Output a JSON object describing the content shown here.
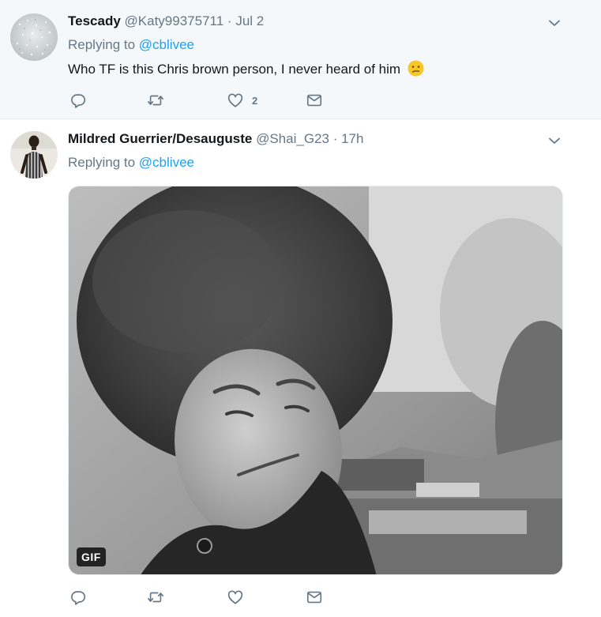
{
  "tweets": [
    {
      "name": "Tescady",
      "handle": "@Katy99375711",
      "separator": "·",
      "time": "Jul 2",
      "replying_to_label": "Replying to",
      "replying_to_handle": "@cblivee",
      "text": "Who TF is this Chris brown person, I never heard of him",
      "emoji": "confused-face-emoji",
      "like_count": "2"
    },
    {
      "name": "Mildred Guerrier/Desauguste",
      "handle": "@Shai_G23",
      "separator": "·",
      "time": "17h",
      "replying_to_label": "Replying to",
      "replying_to_handle": "@cblivee",
      "media_badge": "GIF"
    }
  ],
  "colors": {
    "accent": "#1da1f2",
    "muted": "#657786",
    "highlight_bg": "#f5f8fa",
    "emoji_yellow": "#f9c623"
  },
  "icons": [
    "chevron-down-icon",
    "reply-icon",
    "retweet-icon",
    "like-icon",
    "direct-message-icon"
  ]
}
